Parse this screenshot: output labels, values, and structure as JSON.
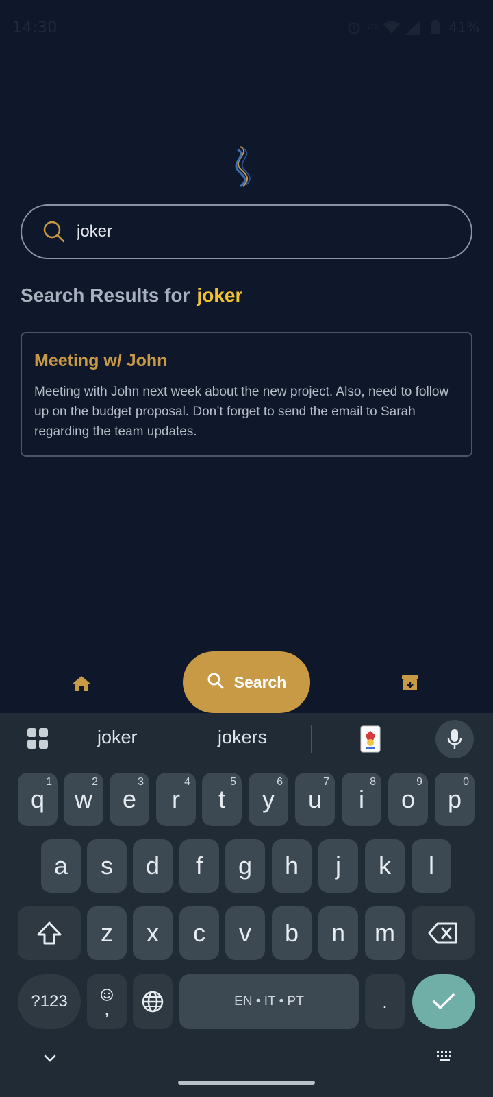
{
  "status_bar": {
    "time": "14:30",
    "lte_label": "LTE",
    "battery": "41%"
  },
  "search": {
    "value": "joker",
    "placeholder": ""
  },
  "results": {
    "heading": "Search Results for",
    "term": "joker"
  },
  "result_card": {
    "title": "Meeting w/ John",
    "body": "Meeting with John next week about the new project. Also, need to follow up on the budget proposal. Don’t forget to send the email to Sarah regarding the team updates."
  },
  "bottom_nav": {
    "search_label": "Search",
    "home_icon": "home-icon",
    "archive_icon": "archive-icon"
  },
  "keyboard": {
    "suggestions": [
      "joker",
      "jokers"
    ],
    "row1": [
      {
        "k": "q",
        "h": "1"
      },
      {
        "k": "w",
        "h": "2"
      },
      {
        "k": "e",
        "h": "3"
      },
      {
        "k": "r",
        "h": "4"
      },
      {
        "k": "t",
        "h": "5"
      },
      {
        "k": "y",
        "h": "6"
      },
      {
        "k": "u",
        "h": "7"
      },
      {
        "k": "i",
        "h": "8"
      },
      {
        "k": "o",
        "h": "9"
      },
      {
        "k": "p",
        "h": "0"
      }
    ],
    "row2": [
      "a",
      "s",
      "d",
      "f",
      "g",
      "h",
      "j",
      "k",
      "l"
    ],
    "row3": [
      "z",
      "x",
      "c",
      "v",
      "b",
      "n",
      "m"
    ],
    "symbols_label": "?123",
    "comma_label": ",",
    "space_label": "EN • IT • PT",
    "period_label": "."
  },
  "colors": {
    "background": "#0f172a",
    "accent": "#c99a45",
    "highlight": "#f2c230",
    "enter": "#6fafa7"
  }
}
